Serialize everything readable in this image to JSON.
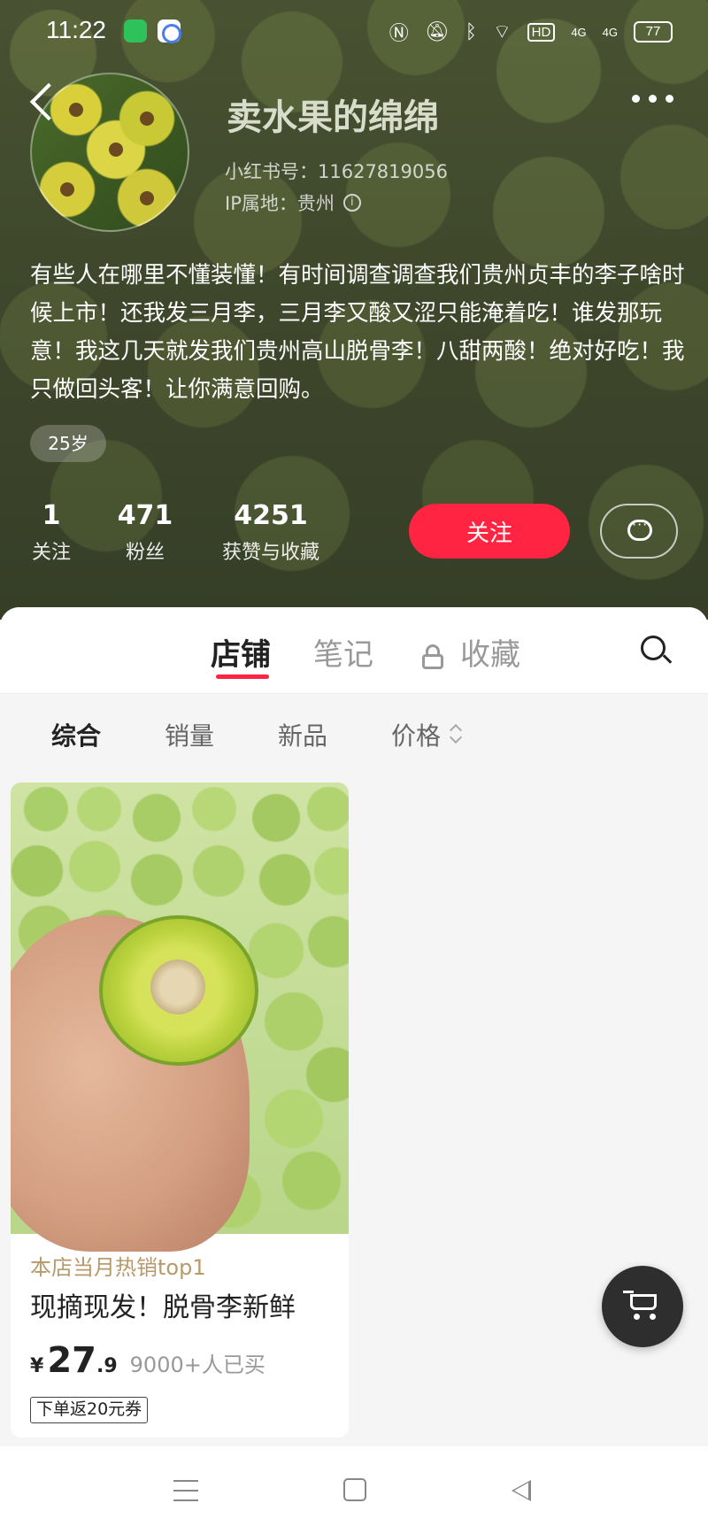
{
  "status_bar": {
    "time": "11:22",
    "network_label": "HD",
    "signal_1": "4G",
    "signal_2": "4G",
    "battery": "77"
  },
  "profile": {
    "name": "卖水果的绵绵",
    "red_id": "小红书号：11627819056",
    "ip_location": "IP属地：贵州",
    "bio": "有些人在哪里不懂装懂！有时间调查调查我们贵州贞丰的李子啥时候上市！还我发三月李，三月李又酸又涩只能淹着吃！谁发那玩意！我这几天就发我们贵州高山脱骨李！八甜两酸！绝对好吃！我只做回头客！让你满意回购。",
    "age_tag": "25岁"
  },
  "stats": [
    {
      "value": "1",
      "label": "关注"
    },
    {
      "value": "471",
      "label": "粉丝"
    },
    {
      "value": "4251",
      "label": "获赞与收藏"
    }
  ],
  "actions": {
    "follow_label": "关注"
  },
  "tabs": [
    {
      "label": "店铺",
      "active": true
    },
    {
      "label": "笔记",
      "active": false
    },
    {
      "label": "收藏",
      "active": false
    }
  ],
  "sort_options": [
    {
      "label": "综合",
      "active": true
    },
    {
      "label": "销量",
      "active": false
    },
    {
      "label": "新品",
      "active": false
    },
    {
      "label": "价格",
      "active": false
    }
  ],
  "product": {
    "tag": "本店当月热销top1",
    "title": "现摘现发！脱骨李新鲜",
    "currency": "¥",
    "price_int": "27",
    "price_dec": ".9",
    "sold": "9000+人已买",
    "coupon": "下单返20元券"
  },
  "colors": {
    "accent": "#ff2442",
    "tag_gold": "#b89a6a"
  }
}
